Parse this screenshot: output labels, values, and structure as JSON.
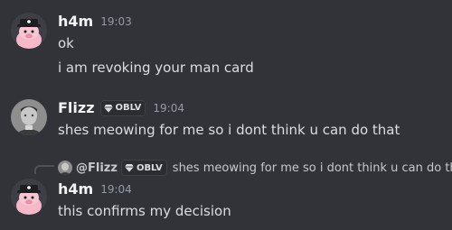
{
  "messages": [
    {
      "author": "h4m",
      "timestamp": "19:03",
      "lines": [
        "ok",
        "i am revoking your man card"
      ]
    },
    {
      "author": "Flizz",
      "tag": "OBLV",
      "timestamp": "19:04",
      "lines": [
        "shes meowing for me so i dont think u can do that"
      ]
    },
    {
      "reply_to": {
        "mention": "@Flizz",
        "tag": "OBLV",
        "text": "shes meowing for me so i dont think u can do that"
      },
      "author": "h4m",
      "timestamp": "19:04",
      "lines": [
        "this confirms my decision"
      ]
    }
  ],
  "colors": {
    "background": "#313338",
    "username": "#f2f3f5",
    "text": "#dbdee1",
    "timestamp": "#949ba4"
  },
  "icons": {
    "tag_icon": "gem-icon"
  }
}
